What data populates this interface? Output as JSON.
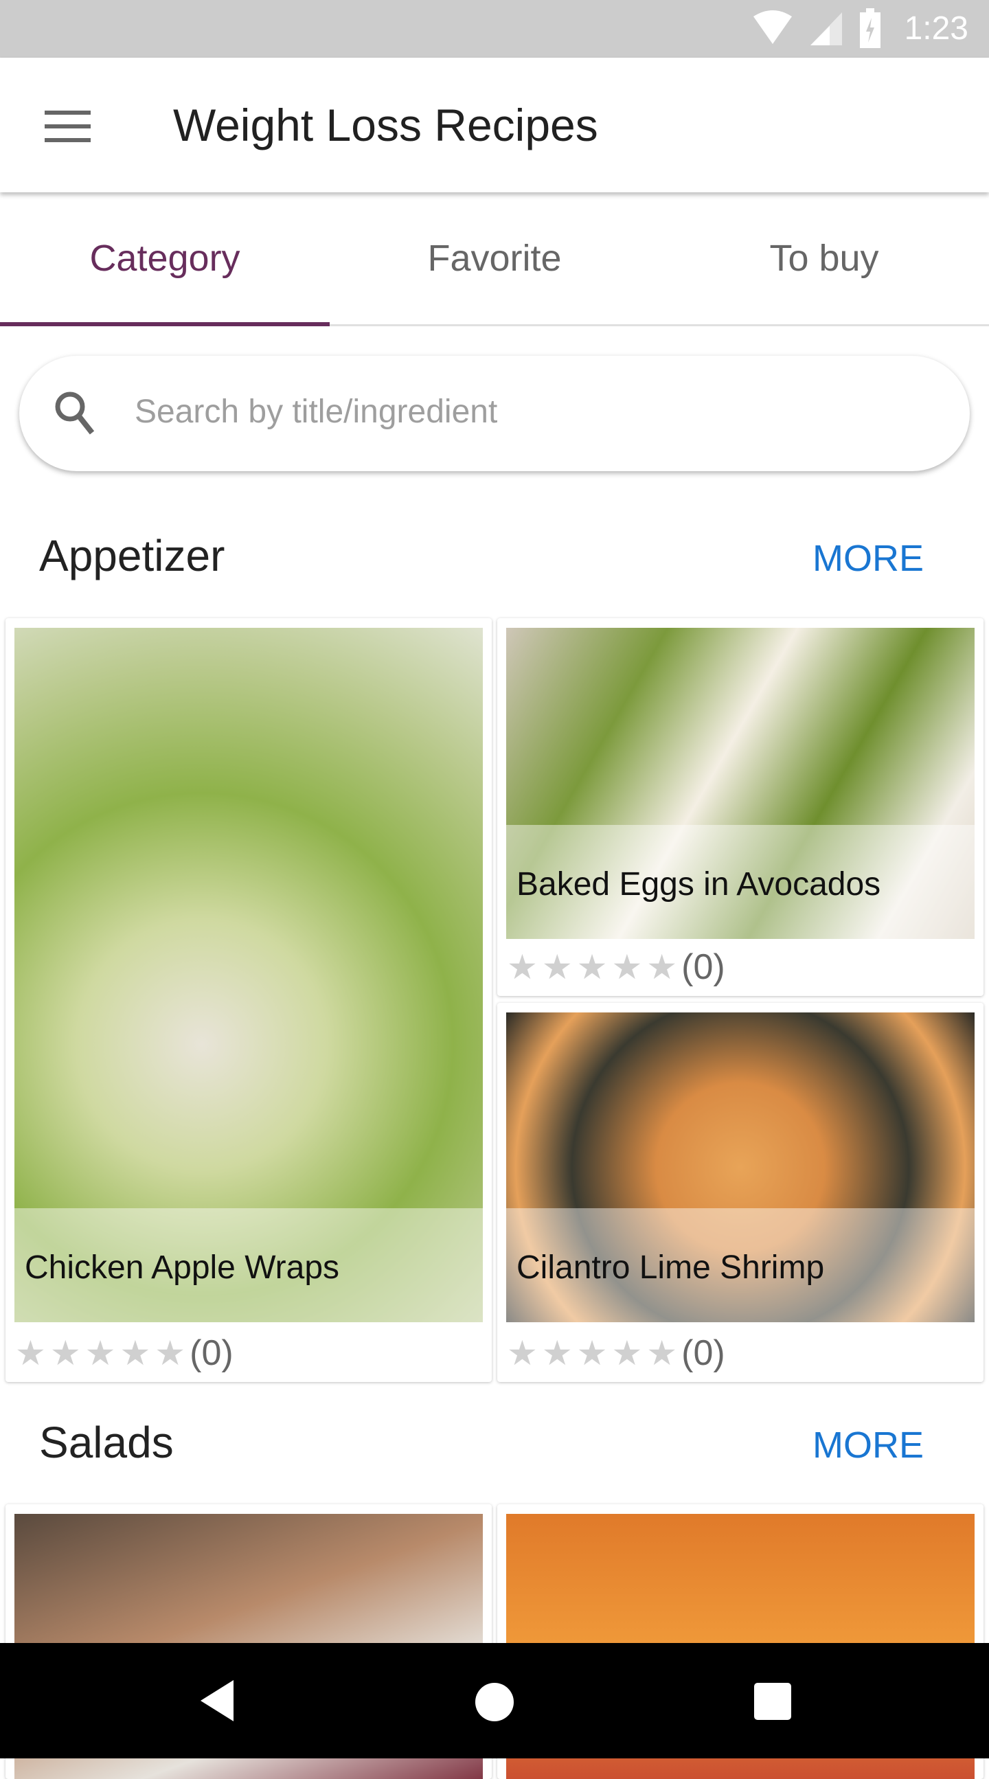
{
  "status_bar": {
    "time": "1:23",
    "icons": [
      "wifi-icon",
      "signal-icon",
      "battery-charging-icon"
    ]
  },
  "toolbar": {
    "title": "Weight Loss Recipes",
    "menu_icon": "hamburger-menu-icon"
  },
  "tabs": [
    {
      "label": "Category",
      "active": true
    },
    {
      "label": "Favorite",
      "active": false
    },
    {
      "label": "To buy",
      "active": false
    }
  ],
  "search": {
    "placeholder": "Search by title/ingredient"
  },
  "sections": [
    {
      "title": "Appetizer",
      "more": "MORE",
      "recipes": [
        {
          "title": "Chicken Apple Wraps",
          "rating": 0,
          "count": "(0)"
        },
        {
          "title": "Baked Eggs in Avocados",
          "rating": 0,
          "count": "(0)"
        },
        {
          "title": "Cilantro Lime Shrimp",
          "rating": 0,
          "count": "(0)"
        }
      ]
    },
    {
      "title": "Salads",
      "more": "MORE"
    }
  ],
  "colors": {
    "accent": "#672d5c",
    "link": "#1976d2"
  }
}
